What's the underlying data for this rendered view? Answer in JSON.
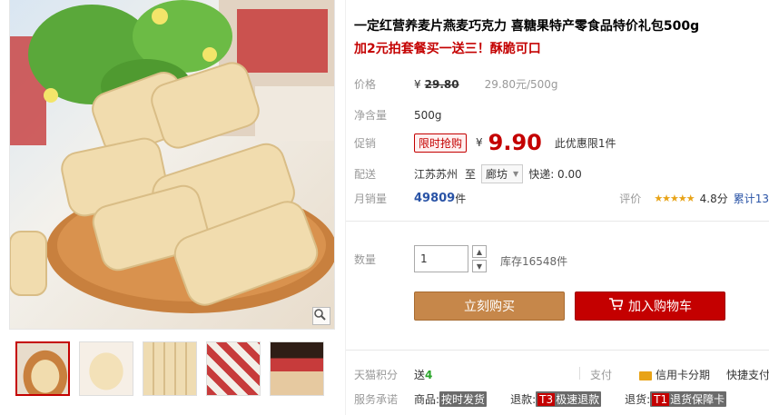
{
  "product": {
    "title": "一定红营养麦片燕麦巧克力 喜糖果特产零食品特价礼包500g",
    "subtitle": "加2元拍套餐买一送三！酥脆可口"
  },
  "price": {
    "label": "价格",
    "currency": "¥",
    "original": "29.80",
    "unit_price": "29.80元/500g"
  },
  "net_weight": {
    "label": "净含量",
    "value": "500g"
  },
  "promo": {
    "label": "促销",
    "tag": "限时抢购",
    "currency": "¥",
    "price": "9.90",
    "limit": "此优惠限1件"
  },
  "shipping": {
    "label": "配送",
    "from": "江苏苏州",
    "to_label": "至",
    "destination": "廊坊",
    "fee": "快递: 0.00"
  },
  "sales": {
    "label": "月销量",
    "count": "49809",
    "unit": "件",
    "rating_label": "评价",
    "stars": "★★★★★",
    "score": "4.8分",
    "total": "累计13"
  },
  "quantity": {
    "label": "数量",
    "value": "1",
    "stock": "库存16548件"
  },
  "buttons": {
    "buy_now": "立刻购买",
    "add_to_cart": "加入购物车"
  },
  "points": {
    "label": "天猫积分",
    "text": "送",
    "amount": "4",
    "pay_label": "支付",
    "credit": "信用卡分期",
    "express": "快捷支付"
  },
  "service": {
    "label": "服务承诺",
    "goods_label": "商品:",
    "goods_tag": "按时发货",
    "refund_label": "退款:",
    "refund_code": "T3",
    "refund_tag": "极速退款",
    "return_label": "退货:",
    "return_code": "T1",
    "return_tag": "退货保障卡"
  },
  "colors": {
    "accent_red": "#c40000",
    "buy_button": "#c6874a",
    "link_blue": "#2953a6"
  }
}
